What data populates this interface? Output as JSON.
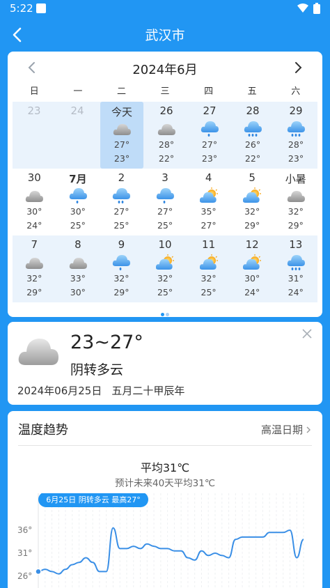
{
  "status": {
    "time": "5:22"
  },
  "header": {
    "title": "武汉市"
  },
  "calendar": {
    "month_title": "2024年6月",
    "weekdays": [
      "日",
      "一",
      "二",
      "三",
      "四",
      "五",
      "六"
    ],
    "rows": [
      [
        {
          "label": "23",
          "icon": "",
          "hi": "",
          "lo": "",
          "faded": true
        },
        {
          "label": "24",
          "icon": "",
          "hi": "",
          "lo": "",
          "faded": true
        },
        {
          "label": "今天",
          "icon": "cloudy",
          "hi": "27°",
          "lo": "23°",
          "today": true
        },
        {
          "label": "26",
          "icon": "cloudy",
          "hi": "28°",
          "lo": "22°"
        },
        {
          "label": "27",
          "icon": "rain-light",
          "hi": "27°",
          "lo": "23°"
        },
        {
          "label": "28",
          "icon": "rain-heavy",
          "hi": "26°",
          "lo": "22°"
        },
        {
          "label": "29",
          "icon": "rain-heavy",
          "hi": "28°",
          "lo": "23°"
        }
      ],
      [
        {
          "label": "30",
          "icon": "cloudy",
          "hi": "30°",
          "lo": "24°"
        },
        {
          "label": "7月",
          "icon": "rain-light",
          "hi": "30°",
          "lo": "25°",
          "bold": true
        },
        {
          "label": "2",
          "icon": "rain-mid",
          "hi": "27°",
          "lo": "25°"
        },
        {
          "label": "3",
          "icon": "rain-light",
          "hi": "27°",
          "lo": "25°"
        },
        {
          "label": "4",
          "icon": "sun-cloud",
          "hi": "35°",
          "lo": "27°"
        },
        {
          "label": "5",
          "icon": "sun-cloud",
          "hi": "32°",
          "lo": "29°"
        },
        {
          "label": "小暑",
          "icon": "cloudy",
          "hi": "32°",
          "lo": "29°"
        }
      ],
      [
        {
          "label": "7",
          "icon": "cloudy",
          "hi": "32°",
          "lo": "29°"
        },
        {
          "label": "8",
          "icon": "cloudy",
          "hi": "33°",
          "lo": "30°"
        },
        {
          "label": "9",
          "icon": "rain-light",
          "hi": "32°",
          "lo": "29°"
        },
        {
          "label": "10",
          "icon": "sun-cloud",
          "hi": "32°",
          "lo": "25°"
        },
        {
          "label": "11",
          "icon": "sun-cloud",
          "hi": "32°",
          "lo": "25°"
        },
        {
          "label": "12",
          "icon": "sun-cloud",
          "hi": "30°",
          "lo": "24°"
        },
        {
          "label": "13",
          "icon": "rain-heavy",
          "hi": "31°",
          "lo": "24°"
        }
      ]
    ],
    "pager": {
      "pages": 2,
      "active": 0
    }
  },
  "today": {
    "temp_range": "23~27°",
    "condition": "阴转多云",
    "date": "2024年06月25日",
    "lunar": "五月二十甲辰年",
    "icon": "cloudy"
  },
  "trend": {
    "title": "温度趋势",
    "high_link": "高温日期",
    "avg": "平均31℃",
    "avg_sub": "预计未来40天平均31℃",
    "tooltip": "6月25日 阴转多云 最高27°",
    "y_ticks": [
      "36°",
      "31°",
      "26°"
    ]
  },
  "chart_data": {
    "type": "line",
    "yticks": [
      26,
      31,
      36
    ],
    "values": [
      27,
      27.5,
      27,
      26.5,
      27.5,
      28.5,
      29,
      30,
      29,
      27,
      27,
      36.5,
      32,
      32,
      32.5,
      32,
      33,
      32.5,
      32,
      32,
      31.5,
      31.5,
      30,
      29.5,
      31.5,
      30.5,
      31,
      30.5,
      30,
      34,
      34.5,
      34.5,
      34.5,
      34.5,
      35.5,
      35.5,
      35.5,
      36,
      30,
      34
    ]
  },
  "colors": {
    "accent": "#2196F3",
    "line": "#3A8FE6",
    "today_bg": "#BFDCF8",
    "shaded_row": "#EAF3FC"
  }
}
